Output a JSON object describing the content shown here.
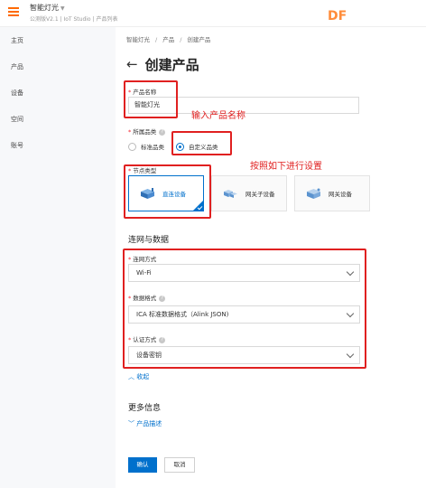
{
  "topbar": {
    "title": "智能灯光",
    "caret": "▼",
    "subtitle": "公测版V2.1 | IoT Studio | 产品列表",
    "logo": "DF",
    "accent": "#ff6a00"
  },
  "sidebar": {
    "items": [
      {
        "label": "主页"
      },
      {
        "label": "产品"
      },
      {
        "label": "设备"
      },
      {
        "label": "空间"
      },
      {
        "label": "账号"
      }
    ]
  },
  "breadcrumb": [
    "智能灯光",
    "产品",
    "创建产品"
  ],
  "page": {
    "back_icon": "←",
    "title": "创建产品"
  },
  "form": {
    "product_name": {
      "label": "产品名称",
      "value": "智能灯光"
    },
    "category": {
      "label": "所属品类",
      "options": [
        {
          "label": "标准品类",
          "checked": false
        },
        {
          "label": "自定义品类",
          "checked": true
        }
      ]
    },
    "node_type": {
      "label": "节点类型",
      "options": [
        {
          "label": "直连设备",
          "selected": true
        },
        {
          "label": "网关子设备",
          "selected": false
        },
        {
          "label": "网关设备",
          "selected": false
        }
      ]
    },
    "network_section_title": "连网与数据",
    "network_method": {
      "label": "连网方式",
      "value": "Wi-Fi"
    },
    "data_format": {
      "label": "数据格式",
      "value": "ICA 标准数据格式（Alink JSON)"
    },
    "auth_method": {
      "label": "认证方式",
      "value": "设备密钥"
    },
    "collapse_link": "收起",
    "more_info_title": "更多信息",
    "product_desc_link": "产品描述"
  },
  "buttons": {
    "confirm": "确认",
    "cancel": "取消"
  },
  "annotations": {
    "enter_name": "输入产品名称",
    "configure": "按照如下进行设置"
  },
  "colors": {
    "primary": "#0070cc",
    "annotation": "#e02020",
    "required": "#f5222d"
  }
}
